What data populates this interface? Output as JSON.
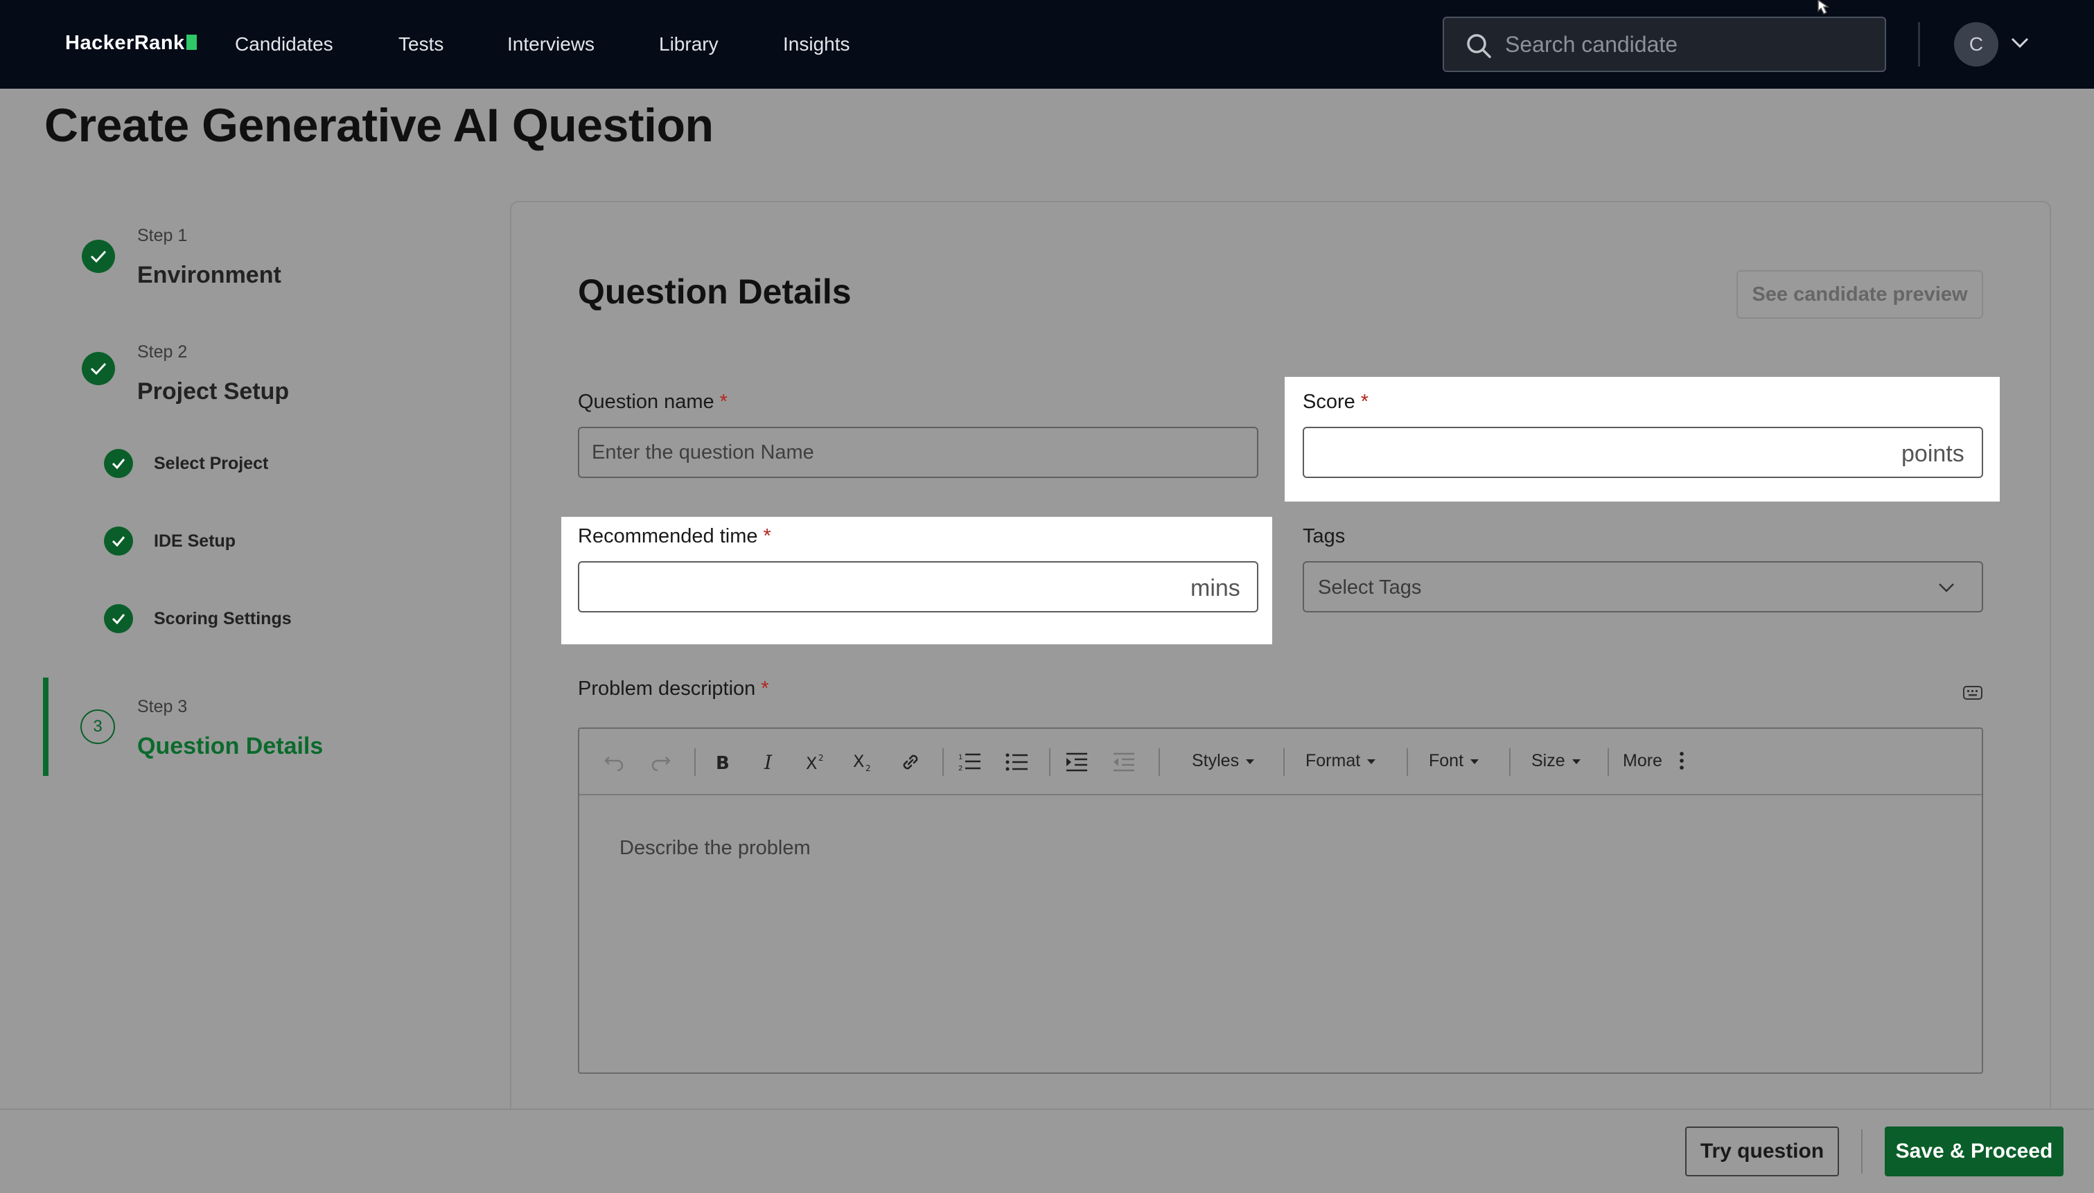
{
  "nav": {
    "logo": "HackerRank",
    "items": [
      "Candidates",
      "Tests",
      "Interviews",
      "Library",
      "Insights"
    ],
    "search_placeholder": "Search candidate",
    "avatar_initial": "C"
  },
  "page": {
    "title": "Create Generative AI Question"
  },
  "stepper": {
    "step1": {
      "label": "Step 1",
      "title": "Environment",
      "status": "complete"
    },
    "step2": {
      "label": "Step 2",
      "title": "Project Setup",
      "status": "complete",
      "substeps": [
        "Select Project",
        "IDE Setup",
        "Scoring Settings"
      ]
    },
    "step3": {
      "label": "Step 3",
      "number": "3",
      "title": "Question Details",
      "status": "active"
    }
  },
  "form": {
    "section_title": "Question Details",
    "preview_button": "See candidate preview",
    "question_name": {
      "label": "Question name",
      "required": "*",
      "placeholder": "Enter the question Name",
      "value": ""
    },
    "score": {
      "label": "Score",
      "required": "*",
      "value": "",
      "suffix": "points"
    },
    "recommended_time": {
      "label": "Recommended time",
      "required": "*",
      "value": "",
      "suffix": "mins"
    },
    "tags": {
      "label": "Tags",
      "placeholder": "Select Tags"
    },
    "problem_description": {
      "label": "Problem description",
      "required": "*",
      "placeholder": "Describe the problem",
      "toolbar": {
        "styles": "Styles",
        "format": "Format",
        "font": "Font",
        "size": "Size",
        "more": "More"
      }
    }
  },
  "footer": {
    "try_button": "Try question",
    "save_button": "Save & Proceed"
  },
  "colors": {
    "nav_bg": "#050b17",
    "brand_green": "#0a5e29",
    "logo_green": "#2ec866",
    "overlay_bg": "#9a9a9a",
    "required": "#b3261e"
  }
}
